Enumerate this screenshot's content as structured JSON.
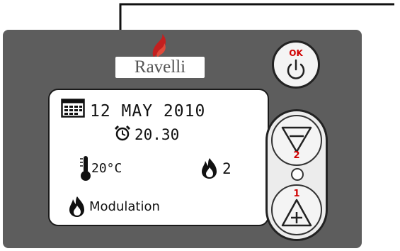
{
  "brand": {
    "logo_text": "Ravelli"
  },
  "display": {
    "date": "12 MAY 2010",
    "time": "20.30",
    "temperature": "20°C",
    "power_level": "2",
    "status": "Modulation"
  },
  "buttons": {
    "ok_label": "OK",
    "minus_number": "2",
    "plus_number": "1"
  },
  "colors": {
    "panel": "#5d5d5d",
    "button_accent": "#d00000",
    "logo_flame": "#c41f1f"
  },
  "icons": [
    "calendar-icon",
    "alarm-clock-icon",
    "thermometer-icon",
    "flame-icon",
    "power-icon",
    "minus-icon",
    "plus-icon"
  ]
}
